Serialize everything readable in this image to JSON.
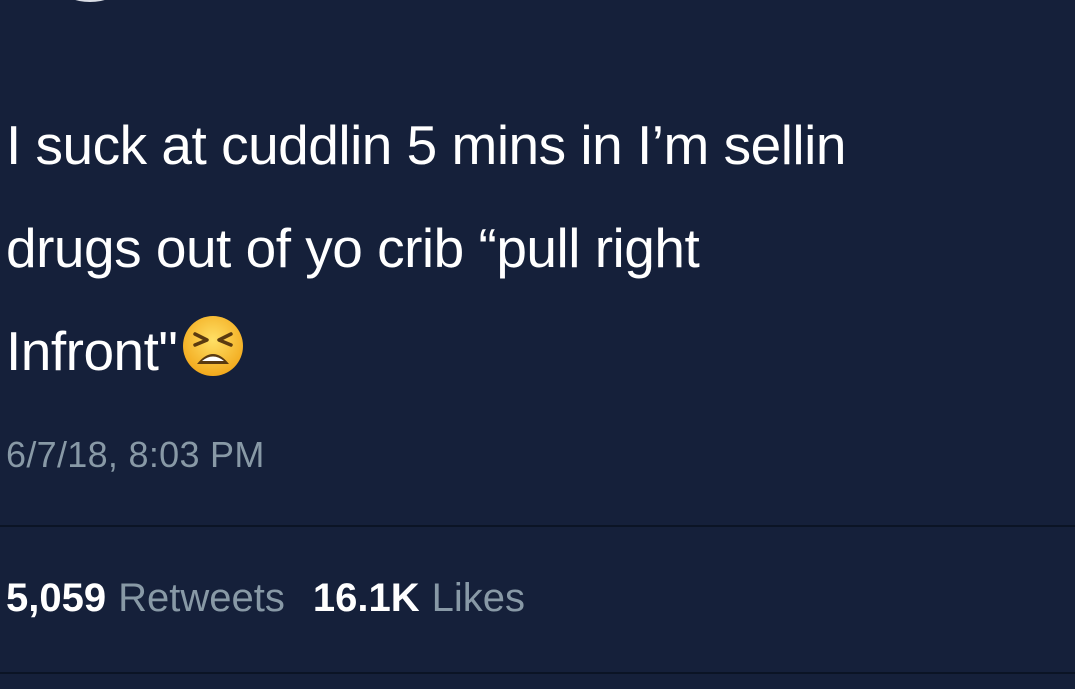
{
  "tweet": {
    "text_lines": [
      "I suck at cuddlin 5 mins in I’m sellin",
      "drugs out of yo crib “pull right",
      "Infront\""
    ],
    "emoji": "tired-face-emoji",
    "timestamp": "6/7/18, 8:03 PM"
  },
  "stats": {
    "retweets_count": "5,059",
    "retweets_label": "Retweets",
    "likes_count": "16.1K",
    "likes_label": "Likes"
  },
  "colors": {
    "background": "#15203a",
    "primary_text": "#ffffff",
    "secondary_text": "#8899a6",
    "emoji_face": "#f7c531"
  }
}
